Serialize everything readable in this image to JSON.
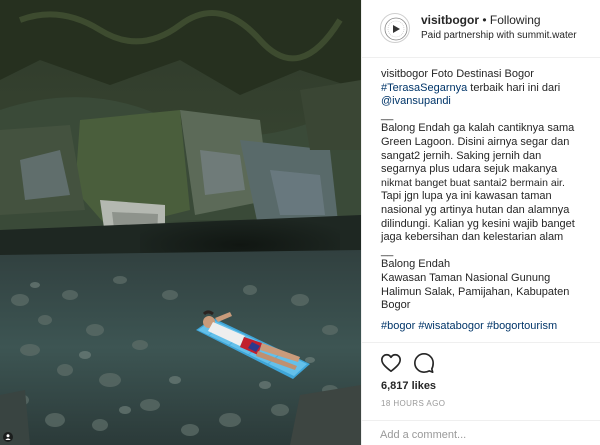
{
  "post": {
    "username": "visitbogor",
    "separator": "•",
    "follow_state": "Following",
    "partnership": "Paid partnership with summit.water",
    "caption": {
      "author": "visitbogor",
      "intro_text": "Foto Destinasi Bogor",
      "intro_tag": "#TerasaSegarnya",
      "intro_rest": "terbaik hari ini dari",
      "credit_mention": "@ivansupandi",
      "separator": "__",
      "body_lines": [
        "Balong Endah ga kalah cantiknya sama",
        "Green Lagoon. Disini airnya segar dan",
        "sangat2 jernih. Saking jernih dan",
        "segarnya plus udara sejuk makanya",
        "nikmat banget buat santai2 bermain air.",
        "Tapi jgn lupa ya ini kawasan taman",
        "nasional yg artinya hutan dan alamnya",
        "dilindungi. Kalian yg kesini wajib banget",
        "jaga kebersihan dan kelestarian alam"
      ],
      "location_lines": [
        "Balong Endah",
        "Kawasan Taman Nasional Gunung",
        "Halimun Salak, Pamijahan, Kabupaten",
        "Bogor"
      ],
      "hashtags": [
        "#bogor",
        "#wisatabogor",
        "#bogortourism"
      ]
    },
    "likes": "6,817 likes",
    "time_ago": "18 HOURS AGO",
    "comment_placeholder": "Add a comment...",
    "icons": {
      "like": "heart-icon",
      "comment": "comment-icon",
      "photo_corner": "user-tag-icon",
      "avatar": "visitbogor-logo"
    },
    "colors": {
      "link": "#003569",
      "text": "#262626",
      "muted": "#999999",
      "divider": "#efefef"
    }
  }
}
